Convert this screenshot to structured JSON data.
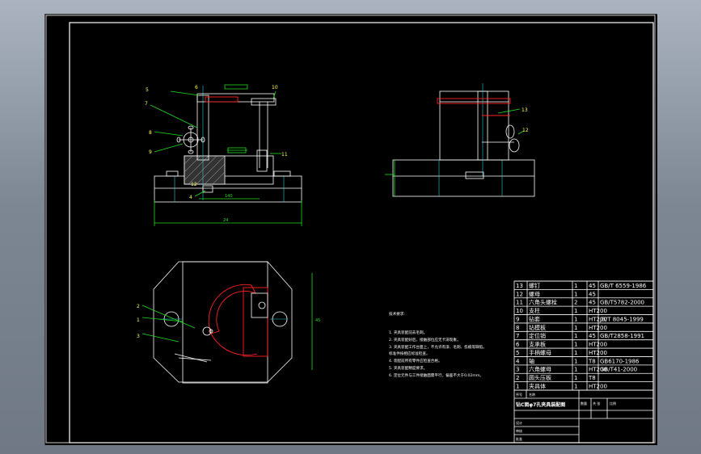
{
  "notes": {
    "title": "技术要求:",
    "lines": [
      "1. 夹具装配前去毛刺。",
      "2. 夹具装配好后，接触部位应无卡滞现象。",
      "3. 夹具装配工作台面上，不允许有漆、毛刺、伤痕等缺陷。",
      "   标准件按相应标准检查。",
      "4. 装配前所有零件应检查合格。",
      "5. 夹具装配精度要求。",
      "6. 定位元件与工件接触面需平行，偏差不大于0.02mm。"
    ]
  },
  "balloons": {
    "front": [
      "5",
      "6",
      "7",
      "8",
      "9",
      "10",
      "11",
      "12",
      "4"
    ],
    "side": [
      "13",
      "12"
    ],
    "top": [
      "2",
      "1",
      "3"
    ]
  },
  "dims": {
    "front_bottom": "24",
    "front_inner": "140",
    "top_vertical": "45"
  },
  "bom": [
    {
      "no": "13",
      "name": "螺钉",
      "qty": "1",
      "mat": "45",
      "std": "GB/T 6559-1986"
    },
    {
      "no": "12",
      "name": "螺母",
      "qty": "1",
      "mat": "45",
      "std": ""
    },
    {
      "no": "11",
      "name": "六角头螺栓",
      "qty": "2",
      "mat": "45",
      "std": "GB/T5782-2000"
    },
    {
      "no": "10",
      "name": "支柱",
      "qty": "1",
      "mat": "HT200",
      "std": ""
    },
    {
      "no": "9",
      "name": "钻套",
      "qty": "1",
      "mat": "HT200",
      "std": "JB/T 8045-1999"
    },
    {
      "no": "8",
      "name": "钻模板",
      "qty": "1",
      "mat": "HT200",
      "std": ""
    },
    {
      "no": "7",
      "name": "定位销",
      "qty": "1",
      "mat": "45",
      "std": "GB/T2858-1991"
    },
    {
      "no": "6",
      "name": "支承板",
      "qty": "1",
      "mat": "HT200",
      "std": ""
    },
    {
      "no": "5",
      "name": "手柄螺母",
      "qty": "1",
      "mat": "HT200",
      "std": ""
    },
    {
      "no": "4",
      "name": "轴",
      "qty": "1",
      "mat": "T8",
      "std": "GB6170-1986"
    },
    {
      "no": "3",
      "name": "六角螺母",
      "qty": "1",
      "mat": "HT200",
      "std": "GB/T41-2000"
    },
    {
      "no": "2",
      "name": "圆头压板",
      "qty": "1",
      "mat": "T8",
      "std": ""
    },
    {
      "no": "1",
      "name": "夹具体",
      "qty": "1",
      "mat": "HT200",
      "std": ""
    }
  ],
  "titleblock": {
    "drawing_name": "钻C面φ7孔夹具装配图",
    "hdr_a": "序号",
    "hdr_b": "名称",
    "scale_label": "比例",
    "sheet_label": "共 张",
    "qty_label": "数量",
    "design": "设计",
    "check": "审核",
    "approve": "批准"
  }
}
